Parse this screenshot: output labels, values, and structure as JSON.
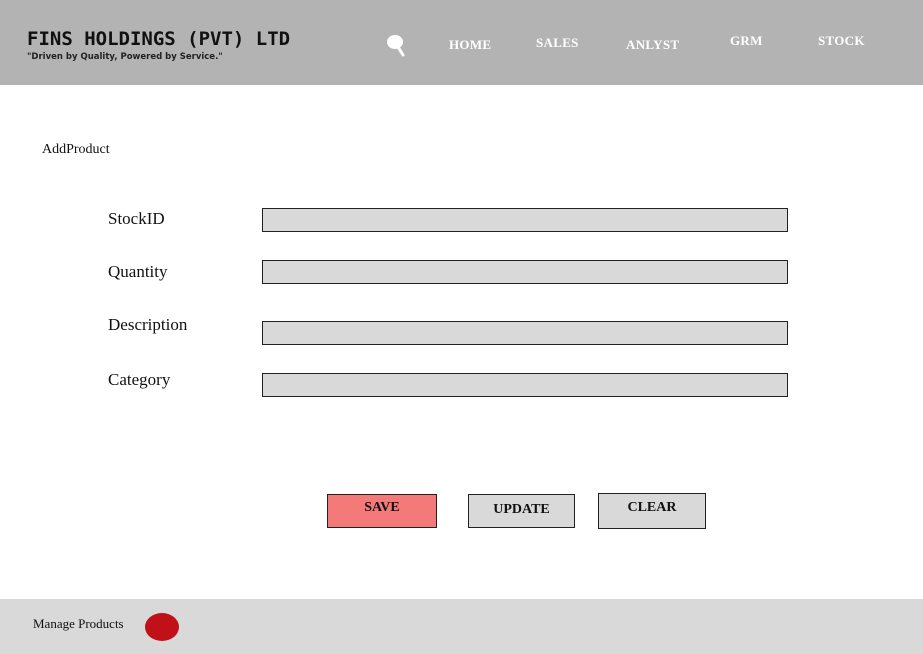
{
  "header": {
    "brand_title": "FINS HOLDINGS (PVT) LTD",
    "brand_tagline": "\"Driven by Quality, Powered by Service.\"",
    "search_icon": "search-icon",
    "nav": {
      "home": "HOME",
      "sales": "SALES",
      "anlyst": "ANLYST",
      "grm": "GRM",
      "stock": "STOCK"
    }
  },
  "main": {
    "heading": "AddProduct",
    "fields": {
      "stockid": {
        "label": "StockID",
        "value": ""
      },
      "quantity": {
        "label": "Quantity",
        "value": ""
      },
      "description": {
        "label": "Description",
        "value": ""
      },
      "category": {
        "label": "Category",
        "value": ""
      }
    },
    "buttons": {
      "save": "SAVE",
      "update": "UPDATE",
      "clear": "CLEAR"
    }
  },
  "footer": {
    "label": "Manage Products",
    "status_color": "#c01018"
  },
  "colors": {
    "header_bg": "#b3b3b3",
    "input_bg": "#d9d9d9",
    "save_button": "#f47a7a",
    "footer_bg": "#d9d9d9"
  }
}
